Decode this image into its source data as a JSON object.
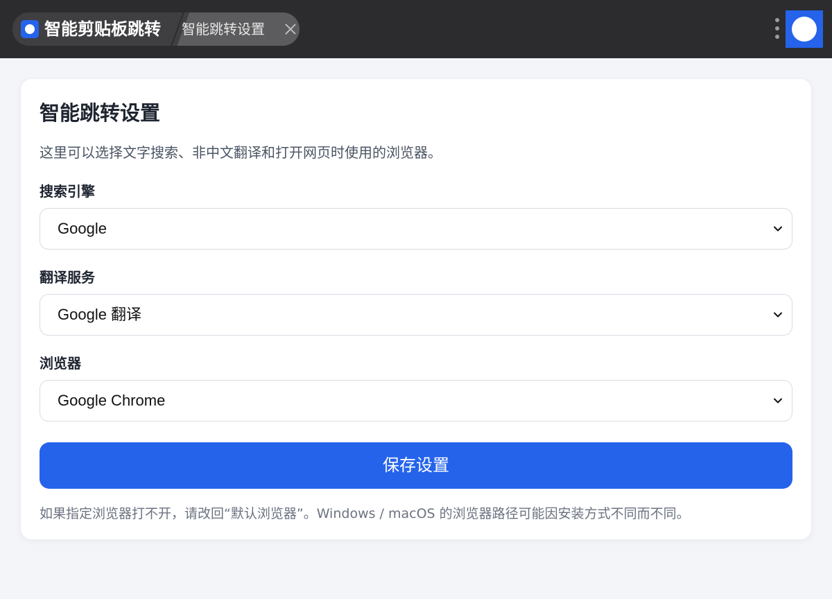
{
  "topbar": {
    "app_title": "智能剪贴板跳转",
    "tab_title": "智能跳转设置",
    "close_icon": "close-icon",
    "menu_icon": "more-vertical-icon",
    "avatar_icon": "avatar-icon"
  },
  "colors": {
    "accent": "#2563eb",
    "topbar_bg": "#2c2c2e",
    "page_bg": "#f3f5f8"
  },
  "card": {
    "title": "智能跳转设置",
    "description": "这里可以选择文字搜索、非中文翻译和打开网页时使用的浏览器。",
    "fields": [
      {
        "label": "搜索引擎",
        "value": "Google"
      },
      {
        "label": "翻译服务",
        "value": "Google 翻译"
      },
      {
        "label": "浏览器",
        "value": "Google Chrome"
      }
    ],
    "save_label": "保存设置",
    "footnote": "如果指定浏览器打不开，请改回“默认浏览器”。Windows / macOS 的浏览器路径可能因安装方式不同而不同。"
  }
}
